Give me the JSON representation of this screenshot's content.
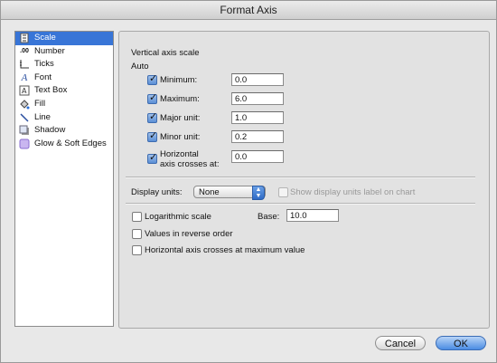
{
  "window": {
    "title": "Format Axis"
  },
  "sidebar": {
    "items": [
      {
        "label": "Scale",
        "icon": "scale-icon",
        "selected": true
      },
      {
        "label": "Number",
        "icon": "number-format-icon",
        "selected": false
      },
      {
        "label": "Ticks",
        "icon": "ticks-icon",
        "selected": false
      },
      {
        "label": "Font",
        "icon": "font-icon",
        "selected": false
      },
      {
        "label": "Text Box",
        "icon": "text-box-icon",
        "selected": false
      },
      {
        "label": "Fill",
        "icon": "fill-bucket-icon",
        "selected": false
      },
      {
        "label": "Line",
        "icon": "line-icon",
        "selected": false
      },
      {
        "label": "Shadow",
        "icon": "shadow-icon",
        "selected": false
      },
      {
        "label": "Glow & Soft Edges",
        "icon": "glow-icon",
        "selected": false
      }
    ]
  },
  "scale": {
    "section_title": "Vertical axis scale",
    "auto_label": "Auto",
    "minimum": {
      "label": "Minimum:",
      "value": "0.0",
      "checked": true
    },
    "maximum": {
      "label": "Maximum:",
      "value": "6.0",
      "checked": true
    },
    "major_unit": {
      "label": "Major unit:",
      "value": "1.0",
      "checked": true
    },
    "minor_unit": {
      "label": "Minor unit:",
      "value": "0.2",
      "checked": true
    },
    "horizontal_crosses": {
      "label_line1": "Horizontal",
      "label_line2": "axis crosses at:",
      "value": "0.0",
      "checked": true
    },
    "display_units_label": "Display units:",
    "display_units_value": "None",
    "show_display_units_label": "Show display units label on chart",
    "logarithmic_label": "Logarithmic scale",
    "base_label": "Base:",
    "base_value": "10.0",
    "reverse_label": "Values in reverse order",
    "max_cross_label": "Horizontal axis crosses at maximum value"
  },
  "buttons": {
    "cancel": "Cancel",
    "ok": "OK"
  },
  "colors": {
    "selection": "#3875d7",
    "ok_button": "#4a8ce3"
  }
}
